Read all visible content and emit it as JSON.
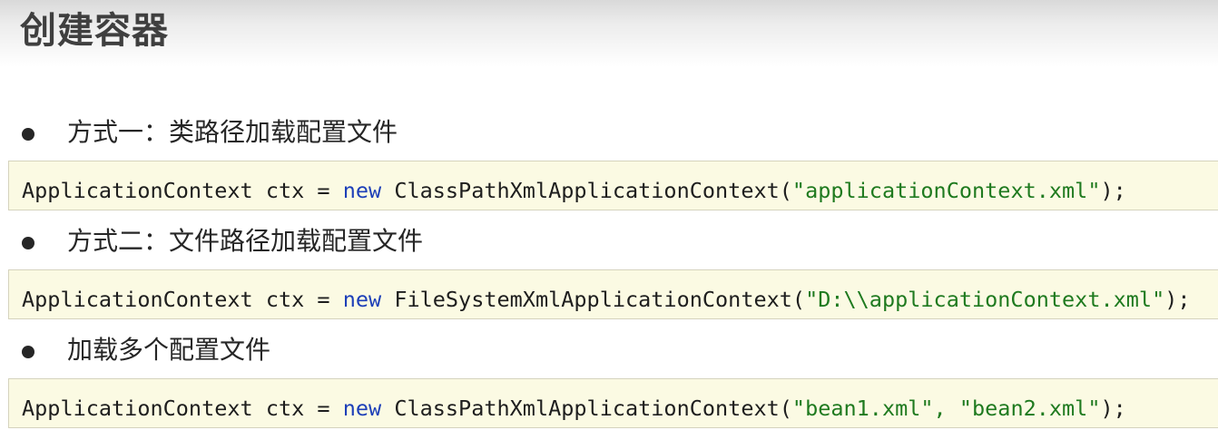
{
  "header": {
    "title": "创建容器"
  },
  "items": [
    {
      "label": "方式一：类路径加载配置文件",
      "code": {
        "type_name": "ApplicationContext",
        "var_assign": " ctx = ",
        "keyword": "new",
        "class_call": " ClassPathXmlApplicationContext(",
        "args": "\"applicationContext.xml\"",
        "close": ");"
      }
    },
    {
      "label": "方式二：文件路径加载配置文件",
      "code": {
        "type_name": "ApplicationContext",
        "var_assign": " ctx = ",
        "keyword": "new",
        "class_call": " FileSystemXmlApplicationContext(",
        "args": "\"D:\\\\applicationContext.xml\"",
        "close": ");"
      }
    },
    {
      "label": "加载多个配置文件",
      "code": {
        "type_name": "ApplicationContext",
        "var_assign": " ctx = ",
        "keyword": "new",
        "class_call": " ClassPathXmlApplicationContext(",
        "args": "\"bean1.xml\", \"bean2.xml\"",
        "close": ");"
      }
    }
  ],
  "colors": {
    "keyword": "#1d3fb8",
    "string": "#1f7a1f",
    "code_background": "#fbfae3",
    "title": "#3f3f3f"
  }
}
